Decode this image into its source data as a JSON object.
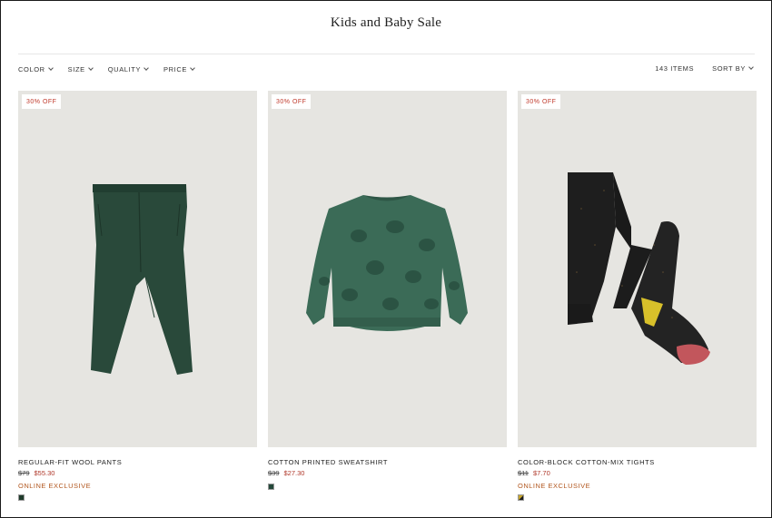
{
  "page": {
    "title": "Kids and Baby Sale"
  },
  "filters": [
    {
      "label": "COLOR"
    },
    {
      "label": "SIZE"
    },
    {
      "label": "QUALITY"
    },
    {
      "label": "PRICE"
    }
  ],
  "toolbar": {
    "item_count": "143 ITEMS",
    "sort_label": "SORT BY"
  },
  "products": [
    {
      "badge": "30% OFF",
      "name": "REGULAR-FIT WOOL PANTS",
      "old_price": "$79",
      "sale_price": "$55.30",
      "tag": "ONLINE EXCLUSIVE",
      "swatch_color": "#1f3b2b"
    },
    {
      "badge": "30% OFF",
      "name": "COTTON PRINTED SWEATSHIRT",
      "old_price": "$39",
      "sale_price": "$27.30",
      "tag": "",
      "swatch_color": "#24483a"
    },
    {
      "badge": "30% OFF",
      "name": "COLOR-BLOCK COTTON-MIX TIGHTS",
      "old_price": "$11",
      "sale_price": "$7.70",
      "tag": "ONLINE EXCLUSIVE",
      "swatch_color": "#c9a62a"
    }
  ],
  "colors": {
    "badge_text": "#c0392b",
    "sale_price": "#b0392b",
    "exclusive": "#b2571f",
    "image_bg": "#e6e5e1"
  }
}
